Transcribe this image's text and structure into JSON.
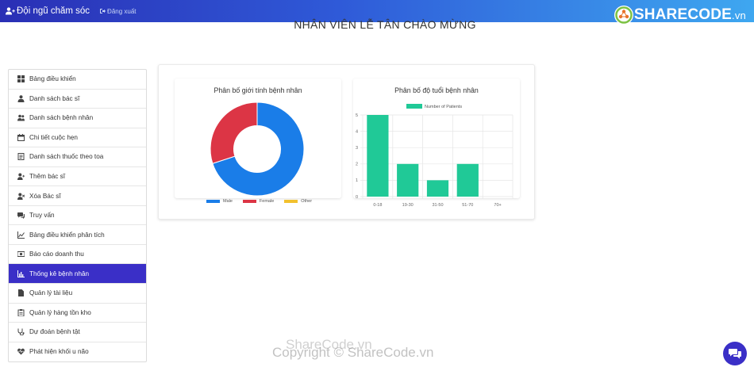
{
  "header": {
    "brand": "Đội ngũ chăm sóc",
    "logout": "Đăng xuất",
    "logo_main": "SHARECODE",
    "logo_suffix": ".vn"
  },
  "page_title": "NHÂN VIÊN LỄ TÂN CHÀO MỪNG",
  "sidebar": {
    "items": [
      {
        "label": "Bảng điều khiển",
        "icon": "dashboard-icon"
      },
      {
        "label": "Danh sách bác sĩ",
        "icon": "doctor-icon"
      },
      {
        "label": "Danh sách bệnh nhân",
        "icon": "users-icon"
      },
      {
        "label": "Chi tiết cuộc hẹn",
        "icon": "calendar-icon"
      },
      {
        "label": "Danh sách thuốc theo toa",
        "icon": "prescription-icon"
      },
      {
        "label": "Thêm bác sĩ",
        "icon": "user-plus-icon"
      },
      {
        "label": "Xóa Bác sĩ",
        "icon": "user-remove-icon"
      },
      {
        "label": "Truy vấn",
        "icon": "comments-icon"
      },
      {
        "label": "Bảng điều khiển phân tích",
        "icon": "line-chart-icon"
      },
      {
        "label": "Báo cáo doanh thu",
        "icon": "money-icon"
      },
      {
        "label": "Thống kê bệnh nhân",
        "icon": "bar-chart-icon",
        "active": true
      },
      {
        "label": "Quản lý tài liệu",
        "icon": "file-icon"
      },
      {
        "label": "Quản lý hàng tồn kho",
        "icon": "clipboard-icon"
      },
      {
        "label": "Dự đoán bệnh tật",
        "icon": "stethoscope-icon"
      },
      {
        "label": "Phát hiện khối u não",
        "icon": "heartbeat-icon"
      }
    ]
  },
  "watermark": "Copyright © ShareCode.vn",
  "watermark2": "ShareCode.vn",
  "chart_data": [
    {
      "type": "pie",
      "title": "Phân bố giới tính bệnh nhân",
      "donut": true,
      "categories": [
        "Male",
        "Female",
        "Other"
      ],
      "values": [
        70,
        30,
        0
      ],
      "colors": [
        "#1a7de8",
        "#dc3545",
        "#f2c12e"
      ],
      "legend": "bottom"
    },
    {
      "type": "bar",
      "title": "Phân bố độ tuổi bệnh nhân",
      "categories": [
        "0-18",
        "19-30",
        "31-50",
        "51-70",
        "70+"
      ],
      "series": [
        {
          "name": "Number of Patients",
          "values": [
            5,
            2,
            1,
            2,
            0
          ],
          "color": "#20c997"
        }
      ],
      "ylim": [
        0,
        5
      ],
      "yticks": [
        0,
        1,
        2,
        3,
        4,
        5
      ],
      "grid": true,
      "legend": "top"
    }
  ]
}
